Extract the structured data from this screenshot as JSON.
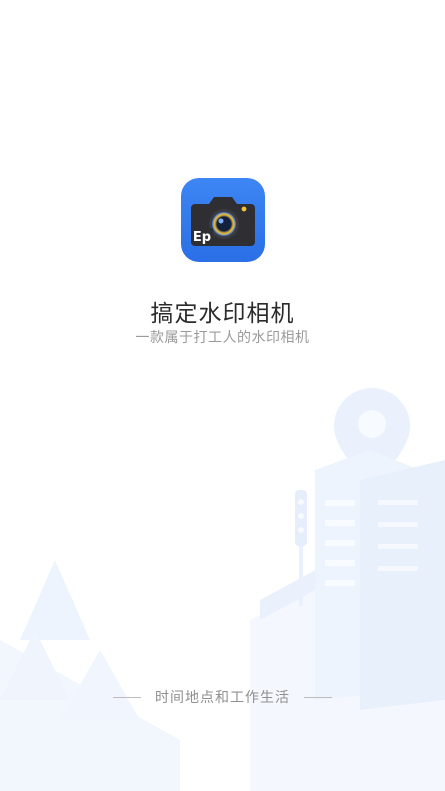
{
  "app": {
    "name": "搞定水印相机",
    "slogan": "一款属于打工人的水印相机",
    "icon": "camera-watermark-app-icon",
    "icon_badge_text": "Ep"
  },
  "footer": {
    "tagline": "时间地点和工作生活"
  },
  "colors": {
    "icon_blue": "#2f7bf1",
    "background": "#ffffff",
    "illustration": "#eef4fd"
  }
}
